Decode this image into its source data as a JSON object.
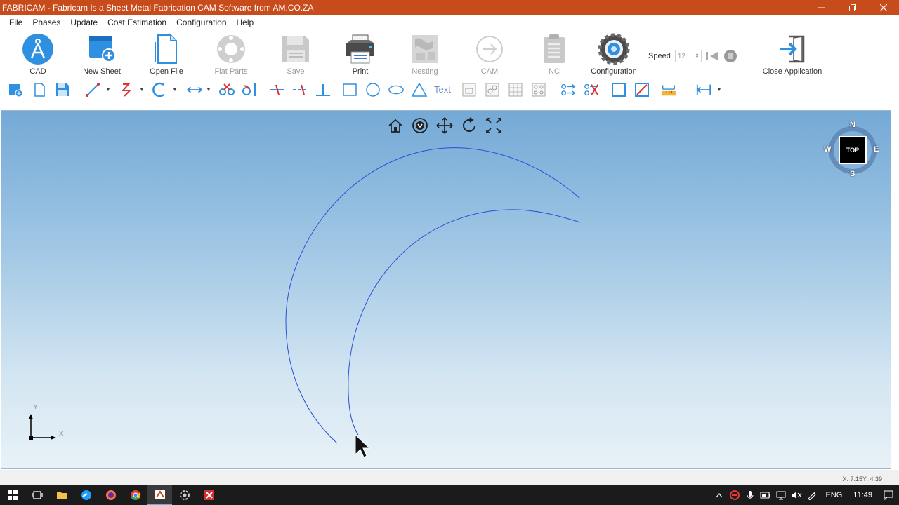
{
  "window": {
    "title": "FABRICAM - Fabricam Is a Sheet Metal Fabrication CAM Software from AM.CO.ZA"
  },
  "menu": [
    "File",
    "Phases",
    "Update",
    "Cost Estimation",
    "Configuration",
    "Help"
  ],
  "ribbon": {
    "cad": "CAD",
    "new_sheet": "New Sheet",
    "open_file": "Open File",
    "flat_parts": "Flat Parts",
    "save": "Save",
    "print": "Print",
    "nesting": "Nesting",
    "cam": "CAM",
    "nc": "NC",
    "configuration": "Configuration",
    "close_application": "Close Application",
    "speed_label": "Speed",
    "speed_value": "12"
  },
  "toolbar": {
    "text_tool": "Text"
  },
  "viewcube": {
    "face": "TOP",
    "north": "N",
    "south": "S",
    "east": "E",
    "west": "W"
  },
  "axes": {
    "x": "X",
    "y": "Y"
  },
  "status": {
    "coordinates": "X: 7.15Y: 4.39"
  },
  "taskbar": {
    "language": "ENG",
    "time": "11:49"
  },
  "colors": {
    "titlebar": "#c84b1b",
    "accent_blue": "#2f8fe0",
    "arc_stroke": "#2b4fd8"
  }
}
